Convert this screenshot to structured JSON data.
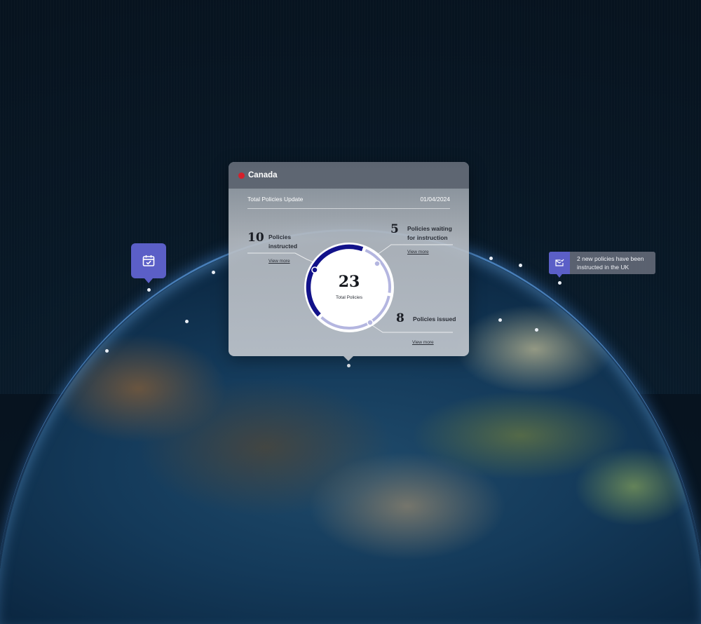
{
  "card": {
    "country": "Canada",
    "title": "Total Policies Update",
    "date": "01/04/2024",
    "total_value": "23",
    "total_label": "Total  Policies",
    "stats": {
      "instructed": {
        "value": "10",
        "label_line1": "Policies",
        "label_line2": "instructed",
        "link": "View more"
      },
      "waiting": {
        "value": "5",
        "label_line1": "Policies waiting",
        "label_line2": "for instruction",
        "link": "View more"
      },
      "issued": {
        "value": "8",
        "label": "Policies issued",
        "link": "View more"
      }
    },
    "donut_segments": [
      {
        "name": "Policies instructed",
        "value": 10,
        "color": "#12128a"
      },
      {
        "name": "Policies waiting for instruction",
        "value": 5,
        "color": "#b4b6e0"
      },
      {
        "name": "Policies issued",
        "value": 8,
        "color": "#b4b6e0"
      }
    ]
  },
  "notification": {
    "text_line1": "2 new policies have been",
    "text_line2": "instructed in the UK",
    "icon": "mail-check-icon"
  },
  "marker": {
    "icon": "calendar-check-icon"
  },
  "colors": {
    "accent": "#5b5fc7",
    "donut_primary": "#12128a",
    "donut_secondary": "#b4b6e0",
    "flag_red": "#d5202b"
  }
}
